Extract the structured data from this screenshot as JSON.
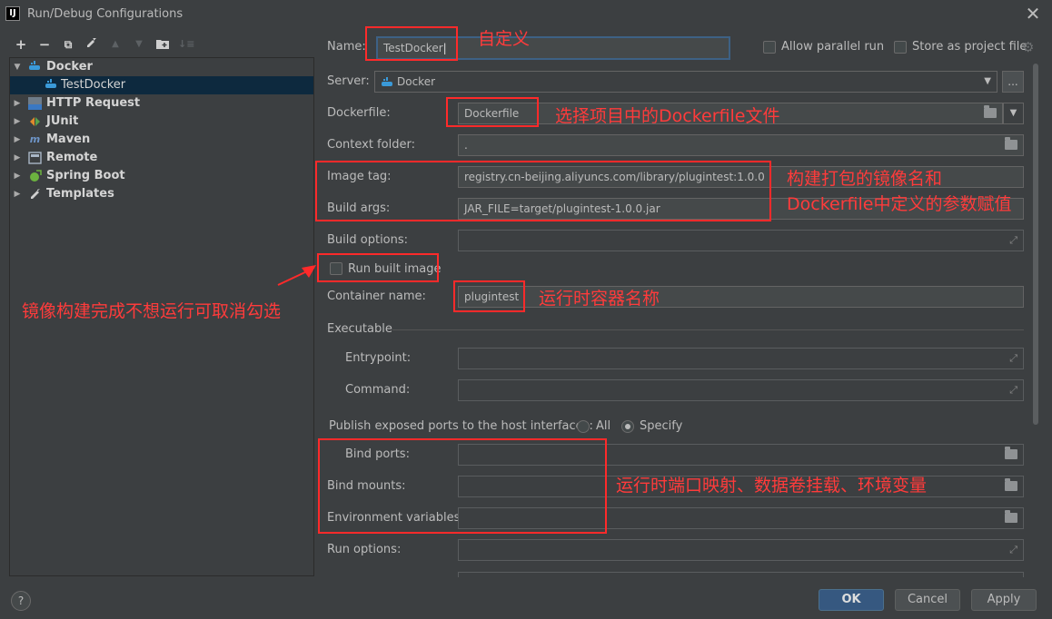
{
  "window": {
    "title": "Run/Debug Configurations",
    "app_icon": "IJ"
  },
  "toolbar": {
    "add": "+",
    "remove": "−",
    "copy": "⧉",
    "edit": "🔧",
    "up": "▲",
    "down": "▼",
    "folder": "📁",
    "sort": "↓≡"
  },
  "tree": {
    "items": [
      {
        "label": "Docker",
        "icon": "docker-icon",
        "expanded": true
      },
      {
        "label": "TestDocker",
        "icon": "docker-icon",
        "selected": true
      },
      {
        "label": "HTTP Request",
        "icon": "api-icon"
      },
      {
        "label": "JUnit",
        "icon": "junit-icon"
      },
      {
        "label": "Maven",
        "icon": "maven-icon"
      },
      {
        "label": "Remote",
        "icon": "remote-icon"
      },
      {
        "label": "Spring Boot",
        "icon": "spring-boot-icon"
      },
      {
        "label": "Templates",
        "icon": "wrench-icon"
      }
    ]
  },
  "form": {
    "name_label": "Name:",
    "name_value": "TestDocker",
    "allow_parallel": "Allow parallel run",
    "store_project": "Store as project file",
    "server_label": "Server:",
    "server_value": "Docker",
    "server_more": "...",
    "dockerfile_label": "Dockerfile:",
    "dockerfile_value": "Dockerfile",
    "context_label": "Context folder:",
    "context_value": ".",
    "image_tag_label": "Image tag:",
    "image_tag_value": "registry.cn-beijing.aliyuncs.com/library/plugintest:1.0.0",
    "build_args_label": "Build args:",
    "build_args_value": "JAR_FILE=target/plugintest-1.0.0.jar",
    "build_options_label": "Build options:",
    "run_built_image": "Run built image",
    "container_name_label": "Container name:",
    "container_name_value": "plugintest",
    "executable_label": "Executable",
    "entrypoint_label": "Entrypoint:",
    "command_label": "Command:",
    "publish_label": "Publish exposed ports to the host interfaces:",
    "publish_all": "All",
    "publish_specify": "Specify",
    "bind_ports_label": "Bind ports:",
    "bind_mounts_label": "Bind mounts:",
    "env_vars_label": "Environment variables:",
    "run_options_label": "Run options:"
  },
  "annotations": {
    "name": "自定义",
    "dockerfile": "选择项目中的Dockerfile文件",
    "image_tag": "构建打包的镜像名和",
    "build_args": "Dockerfile中定义的参数赋值",
    "run_built": "镜像构建完成不想运行可取消勾选",
    "container": "运行时容器名称",
    "ports": "运行时端口映射、数据卷挂载、环境变量"
  },
  "buttons": {
    "help": "?",
    "ok": "OK",
    "cancel": "Cancel",
    "apply": "Apply"
  },
  "colors": {
    "annotation": "#ff2a2a",
    "selection": "#0d293e",
    "primary_button": "#365880"
  }
}
